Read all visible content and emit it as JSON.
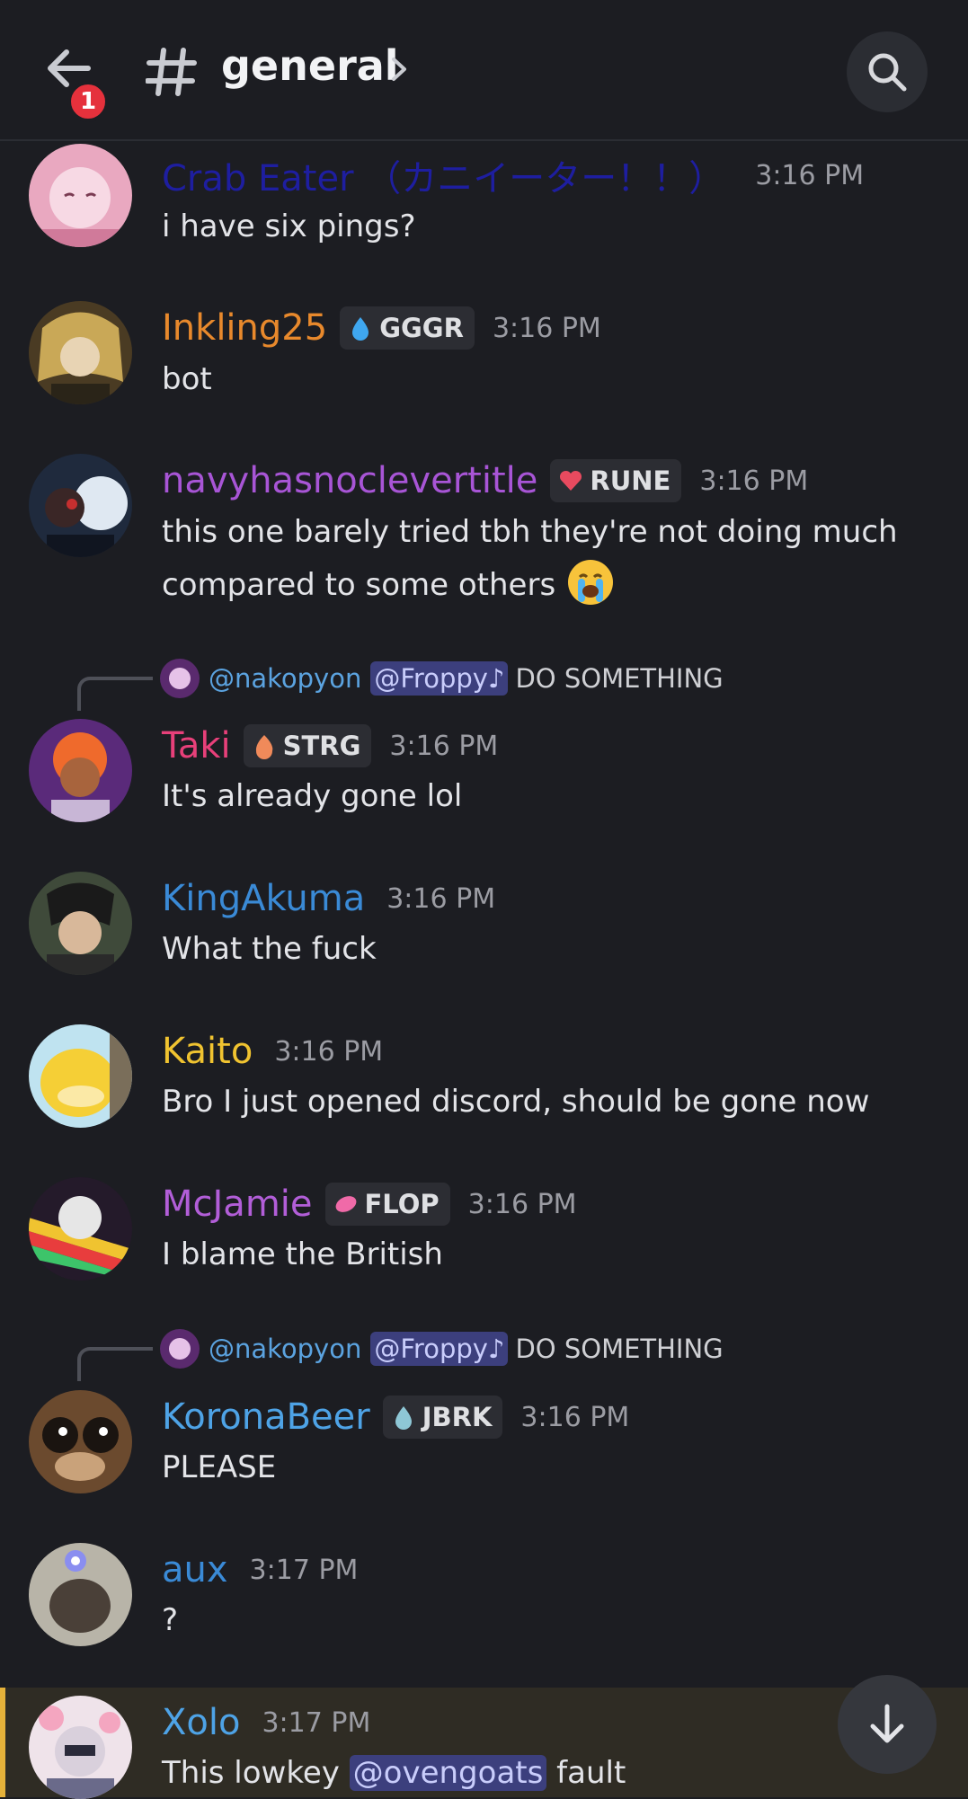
{
  "header": {
    "back_badge": "1",
    "channel_name": "general"
  },
  "messages": [
    {
      "username": "Crab Eater （カニイーター！！）",
      "color": "#1e1ea0",
      "tag": null,
      "time": "3:16 PM",
      "text": "i have six pings?"
    },
    {
      "username": "Inkling25",
      "color": "#e8892c",
      "tag": "GGGR",
      "time": "3:16 PM",
      "text": "bot"
    },
    {
      "username": "navyhasnoclevertitle",
      "color": "#a855d6",
      "tag": "RUNE",
      "time": "3:16 PM",
      "text_line1": "this one barely tried tbh they're not doing much",
      "text_line2": "compared to some others",
      "emoji": "loudly-crying-face"
    },
    {
      "reply": {
        "user": "@nakopyon",
        "mention": "@Froppy♪",
        "text": "DO SOMETHING"
      },
      "username": "Taki",
      "color": "#e8407a",
      "tag": "STRG",
      "time": "3:16 PM",
      "text": "It's already gone lol"
    },
    {
      "username": "KingAkuma",
      "color": "#3a8ad6",
      "tag": null,
      "time": "3:16 PM",
      "text": "What the fuck"
    },
    {
      "username": "Kaito",
      "color": "#f0c330",
      "tag": null,
      "time": "3:16 PM",
      "text": "Bro I just opened discord, should be gone now"
    },
    {
      "username": "McJamie",
      "color": "#b25ed8",
      "tag": "FLOP",
      "time": "3:16 PM",
      "text": "I blame the British"
    },
    {
      "reply": {
        "user": "@nakopyon",
        "mention": "@Froppy♪",
        "text": "DO SOMETHING"
      },
      "username": "KoronaBeer",
      "color": "#4ea3e6",
      "tag": "JBRK",
      "time": "3:16 PM",
      "text": "PLEASE"
    },
    {
      "username": "aux",
      "color": "#3a8ad6",
      "tag": null,
      "time": "3:17 PM",
      "text": "?"
    },
    {
      "username": "Xolo",
      "color": "#4ea3e6",
      "tag": null,
      "time": "3:17 PM",
      "text_before": "This lowkey",
      "mention": "@ovengoats",
      "text_after": "fault"
    }
  ]
}
